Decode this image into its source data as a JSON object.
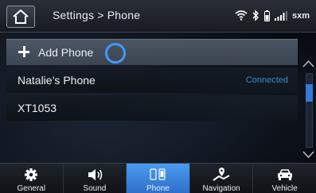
{
  "header": {
    "breadcrumb": "Settings > Phone",
    "status_icons": [
      "wifi-icon",
      "bluetooth-icon",
      "phone-battery-icon",
      "signal-bars-icon"
    ],
    "sxm_label": "sxm"
  },
  "list": {
    "add_label": "Add Phone",
    "devices": [
      {
        "name": "Natalie’s Phone",
        "status": "Connected"
      },
      {
        "name": "XT1053",
        "status": ""
      }
    ]
  },
  "nav": {
    "tabs": [
      {
        "label": "General",
        "icon": "gear-icon"
      },
      {
        "label": "Sound",
        "icon": "speaker-icon"
      },
      {
        "label": "Phone",
        "icon": "phone-icon"
      },
      {
        "label": "Navigation",
        "icon": "map-pin-icon"
      },
      {
        "label": "Vehicle",
        "icon": "car-icon"
      }
    ],
    "active": "Phone"
  },
  "colors": {
    "accent": "#2f7fe0",
    "connected": "#3a8ed6",
    "touch_ring": "#3f9bff"
  }
}
